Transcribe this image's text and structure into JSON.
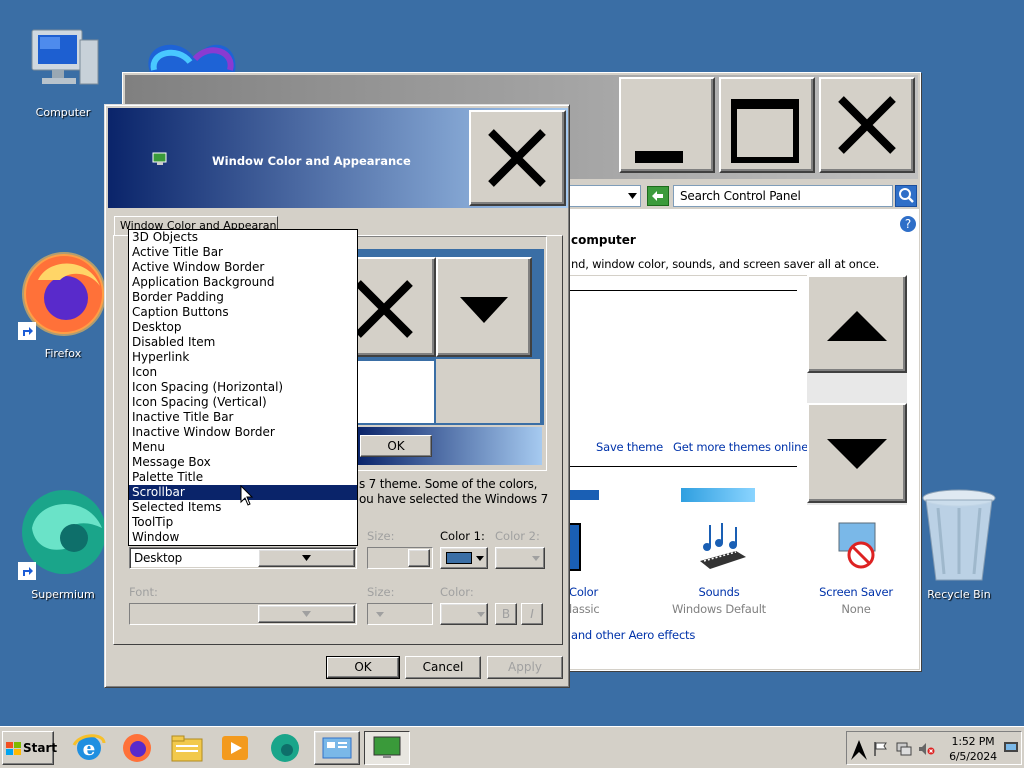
{
  "desktop": {
    "icons": [
      {
        "label": "Computer"
      },
      {
        "label": "Firefox"
      },
      {
        "label": "Supermium"
      },
      {
        "label": "Recycle Bin"
      }
    ]
  },
  "control_panel": {
    "search_placeholder": "Search Control Panel",
    "heading": "computer",
    "description": "nd, window color, sounds, and screen saver all at once.",
    "save_theme": "Save theme",
    "get_more_themes": "Get more themes online",
    "items": [
      {
        "label": "Color",
        "sub": "lassic"
      },
      {
        "label": "Sounds",
        "sub": "Windows Default"
      },
      {
        "label": "Screen Saver",
        "sub": "None"
      }
    ],
    "aero_link": "and other Aero effects"
  },
  "dialog": {
    "title": "Window Color and Appearance",
    "tab": "Window Color and Appearance",
    "preview_ok": "OK",
    "info_line1": "s 7 theme.  Some of the colors,",
    "info_line2": "ou have selected the Windows 7",
    "item_dropdown_value": "Desktop",
    "size_label": "Size:",
    "color1_label": "Color 1:",
    "color2_label": "Color 2:",
    "font_label": "Font:",
    "font_size_label": "Size:",
    "font_color_label": "Color:",
    "bold_label": "B",
    "italic_label": "I",
    "color1_value": "#3a6ea5",
    "buttons": {
      "ok": "OK",
      "cancel": "Cancel",
      "apply": "Apply"
    },
    "list_items": [
      "3D Objects",
      "Active Title Bar",
      "Active Window Border",
      "Application Background",
      "Border Padding",
      "Caption Buttons",
      "Desktop",
      "Disabled Item",
      "Hyperlink",
      "Icon",
      "Icon Spacing (Horizontal)",
      "Icon Spacing (Vertical)",
      "Inactive Title Bar",
      "Inactive Window Border",
      "Menu",
      "Message Box",
      "Palette Title",
      "Scrollbar",
      "Selected Items",
      "ToolTip",
      "Window"
    ],
    "selected_item": "Scrollbar"
  },
  "taskbar": {
    "start_label": "Start",
    "time": "1:52 PM",
    "date": "6/5/2024"
  }
}
